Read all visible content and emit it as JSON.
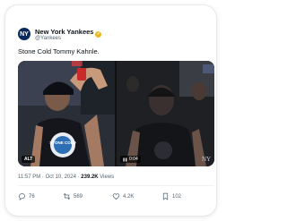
{
  "account": {
    "name": "New York Yankees",
    "handle": "@Yankees",
    "avatar_text": "NY"
  },
  "tweet": {
    "text": "Stone Cold Tommy Kahnle."
  },
  "media": {
    "left": {
      "alt_label": "ALT",
      "shirt_text": "STONE COLD"
    },
    "right": {
      "duration": "0:04"
    }
  },
  "meta": {
    "time": "11:57 PM · Oct 10, 2024 · ",
    "views_count": "239.2K",
    "views_label": " Views"
  },
  "actions": {
    "replies": "76",
    "reposts": "569",
    "likes": "4.2K",
    "bookmarks": "102"
  },
  "colors": {
    "text_primary": "#0f1419",
    "text_secondary": "#536471",
    "verified_badge": "#e8b923",
    "avatar_bg": "#0a2a5c"
  }
}
